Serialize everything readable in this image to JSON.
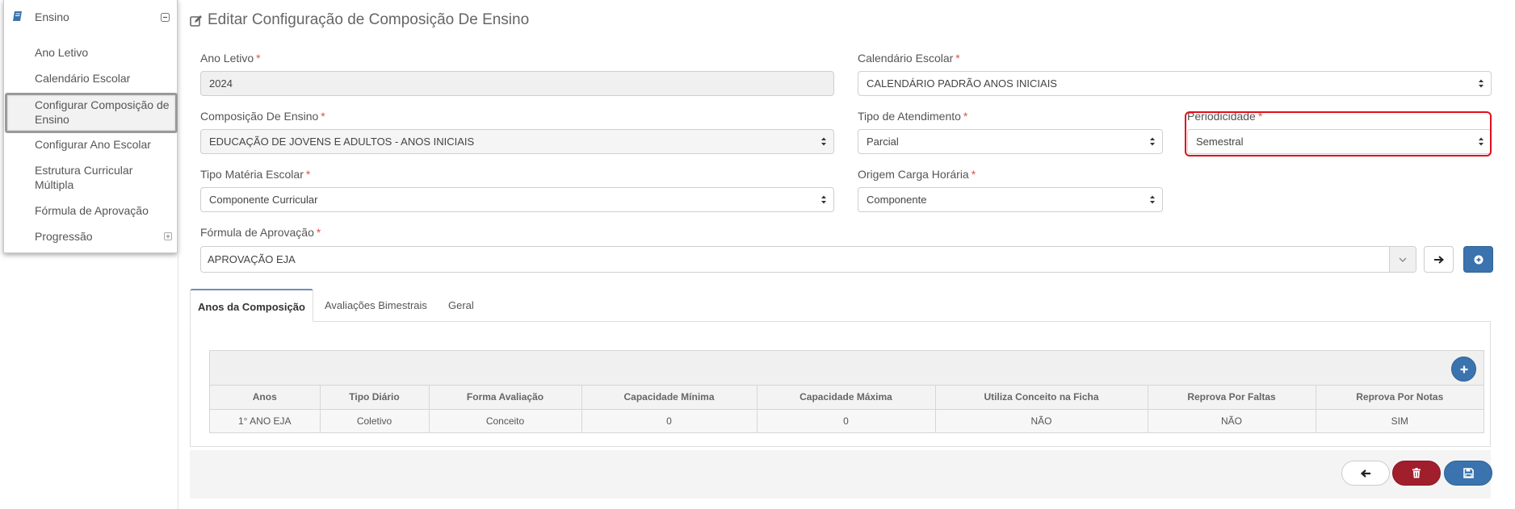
{
  "sidebar": {
    "header": {
      "title": "Ensino"
    },
    "items": [
      {
        "label": "Ano Letivo"
      },
      {
        "label": "Calendário Escolar"
      },
      {
        "label": "Configurar Composição de",
        "label2": "Ensino"
      },
      {
        "label": "Configurar Ano Escolar"
      },
      {
        "label": "Estrutura Curricular",
        "label2": "Múltipla"
      },
      {
        "label": "Fórmula de Aprovação"
      },
      {
        "label": "Progressão"
      }
    ]
  },
  "page": {
    "title": "Editar Configuração de Composição De Ensino"
  },
  "form": {
    "ano_letivo": {
      "label": "Ano Letivo",
      "value": "2024"
    },
    "calendario": {
      "label": "Calendário Escolar",
      "value": "CALENDÁRIO PADRÃO ANOS INICIAIS"
    },
    "composicao": {
      "label": "Composição De Ensino",
      "value": "EDUCAÇÃO DE JOVENS E ADULTOS - ANOS INICIAIS"
    },
    "tipo_atendimento": {
      "label": "Tipo de Atendimento",
      "value": "Parcial"
    },
    "periodicidade": {
      "label": "Periodicidade",
      "value": "Semestral"
    },
    "tipo_materia": {
      "label": "Tipo Matéria Escolar",
      "value": "Componente Curricular"
    },
    "origem_carga": {
      "label": "Origem Carga Horária",
      "value": "Componente"
    },
    "formula": {
      "label": "Fórmula de Aprovação",
      "value": "APROVAÇÃO EJA"
    },
    "required_mark": "*"
  },
  "tabs": [
    {
      "label": "Anos da Composição",
      "active": true
    },
    {
      "label": "Avaliações Bimestrais",
      "active": false
    },
    {
      "label": "Geral",
      "active": false
    }
  ],
  "table": {
    "headers": [
      "Anos",
      "Tipo Diário",
      "Forma Avaliação",
      "Capacidade Mínima",
      "Capacidade Máxima",
      "Utiliza Conceito na Ficha",
      "Reprova Por Faltas",
      "Reprova Por Notas"
    ],
    "rows": [
      [
        "1° ANO EJA",
        "Coletivo",
        "Conceito",
        "0",
        "0",
        "NÃO",
        "NÃO",
        "SIM"
      ]
    ]
  },
  "colors": {
    "primary": "#3a73ad",
    "danger": "#a11e2c",
    "highlight": "#e0101a",
    "sidebar_icon": "#3a73ad"
  },
  "icons": {
    "sidebar": "book-icon",
    "collapse": "minus-square-icon",
    "expand": "plus-square-icon",
    "title": "edit-icon",
    "select": "chevron-updown-icon",
    "arrow": "arrow-right-icon",
    "add": "plus-circle-icon",
    "back": "arrow-left-icon",
    "delete": "trash-icon",
    "save": "save-icon"
  }
}
